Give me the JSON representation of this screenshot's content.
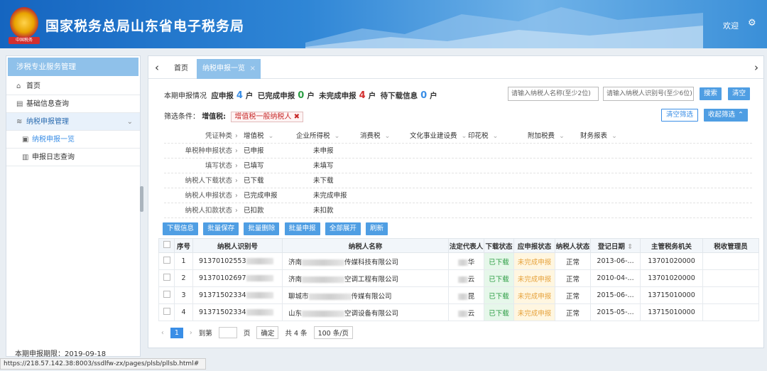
{
  "header": {
    "title": "国家税务总局山东省电子税务局",
    "welcome": "欢迎",
    "emblem_text": "中国税务"
  },
  "sidebar": {
    "head": "涉税专业服务管理",
    "items": [
      {
        "label": "首页"
      },
      {
        "label": "基础信息查询"
      },
      {
        "label": "纳税申报管理"
      },
      {
        "label": "纳税申报一览"
      },
      {
        "label": "申报日志查询"
      }
    ],
    "footer": "本期申报期限：2019-09-18"
  },
  "status_url": "https://218.57.142.38:8003/ssdlfw-zx/pages/plsb/pllsb.html#",
  "tabs": {
    "home": "首页",
    "current": "纳税申报一览"
  },
  "summary": {
    "label": "本期申报情况",
    "due_label": "应申报",
    "due": "4",
    "unit": "户",
    "done_label": "已完成申报",
    "done": "0",
    "undone_label": "未完成申报",
    "undone": "4",
    "download_label": "待下载信息",
    "download": "0"
  },
  "search": {
    "name_placeholder": "请输入纳税人名称(至少2位)",
    "id_placeholder": "请输入纳税人识别号(至少6位)",
    "search": "搜索",
    "clear": "清空"
  },
  "filter": {
    "label": "筛选条件：",
    "tax": "增值税:",
    "tag": "增值税一般纳税人",
    "clear_btn": "清空筛选",
    "collapse_btn": "收起筛选"
  },
  "criteria": [
    {
      "label": "凭证种类",
      "opts": [
        "增值税",
        "企业所得税",
        "消费税",
        "文化事业建设费",
        "印花税",
        "附加税费",
        "财务报表"
      ]
    },
    {
      "label": "单税种申报状态",
      "opts": [
        "已申报",
        "未申报"
      ]
    },
    {
      "label": "填写状态",
      "opts": [
        "已填写",
        "未填写"
      ]
    },
    {
      "label": "纳税人下载状态",
      "opts": [
        "已下载",
        "未下载"
      ]
    },
    {
      "label": "纳税人申报状态",
      "opts": [
        "已完成申报",
        "未完成申报"
      ]
    },
    {
      "label": "纳税人扣款状态",
      "opts": [
        "已扣款",
        "未扣款"
      ]
    }
  ],
  "actions": [
    "下载信息",
    "批量保存",
    "批量删除",
    "批量申报",
    "全部展开",
    "刷新"
  ],
  "table": {
    "headers": [
      "序号",
      "纳税人识别号",
      "纳税人名称",
      "法定代表人",
      "下载状态",
      "应申报状态",
      "纳税人状态",
      "登记日期",
      "主管税务机关",
      "税收管理员"
    ],
    "rows": [
      {
        "no": "1",
        "id": "91370102553",
        "name_a": "济南",
        "name_b": "传媒科技有限公司",
        "rep": "华",
        "dl": "已下载",
        "sb": "未完成申报",
        "st": "正常",
        "date": "2013-06-...",
        "org": "13701020000"
      },
      {
        "no": "2",
        "id": "91370102697",
        "name_a": "济南",
        "name_b": "空调工程有限公司",
        "rep": "云",
        "dl": "已下载",
        "sb": "未完成申报",
        "st": "正常",
        "date": "2010-04-...",
        "org": "13701020000"
      },
      {
        "no": "3",
        "id": "91371502334",
        "name_a": "聊城市",
        "name_b": "传媒有限公司",
        "rep": "昆",
        "dl": "已下载",
        "sb": "未完成申报",
        "st": "正常",
        "date": "2015-06-...",
        "org": "13715010000"
      },
      {
        "no": "4",
        "id": "91371502334",
        "name_a": "山东",
        "name_b": "空调设备有限公司",
        "rep": "云",
        "dl": "已下载",
        "sb": "未完成申报",
        "st": "正常",
        "date": "2015-05-...",
        "org": "13715010000"
      }
    ]
  },
  "pager": {
    "page": "1",
    "goto": "到第",
    "page_unit": "页",
    "confirm": "确定",
    "total": "共 4 条",
    "size": "100 条/页"
  }
}
